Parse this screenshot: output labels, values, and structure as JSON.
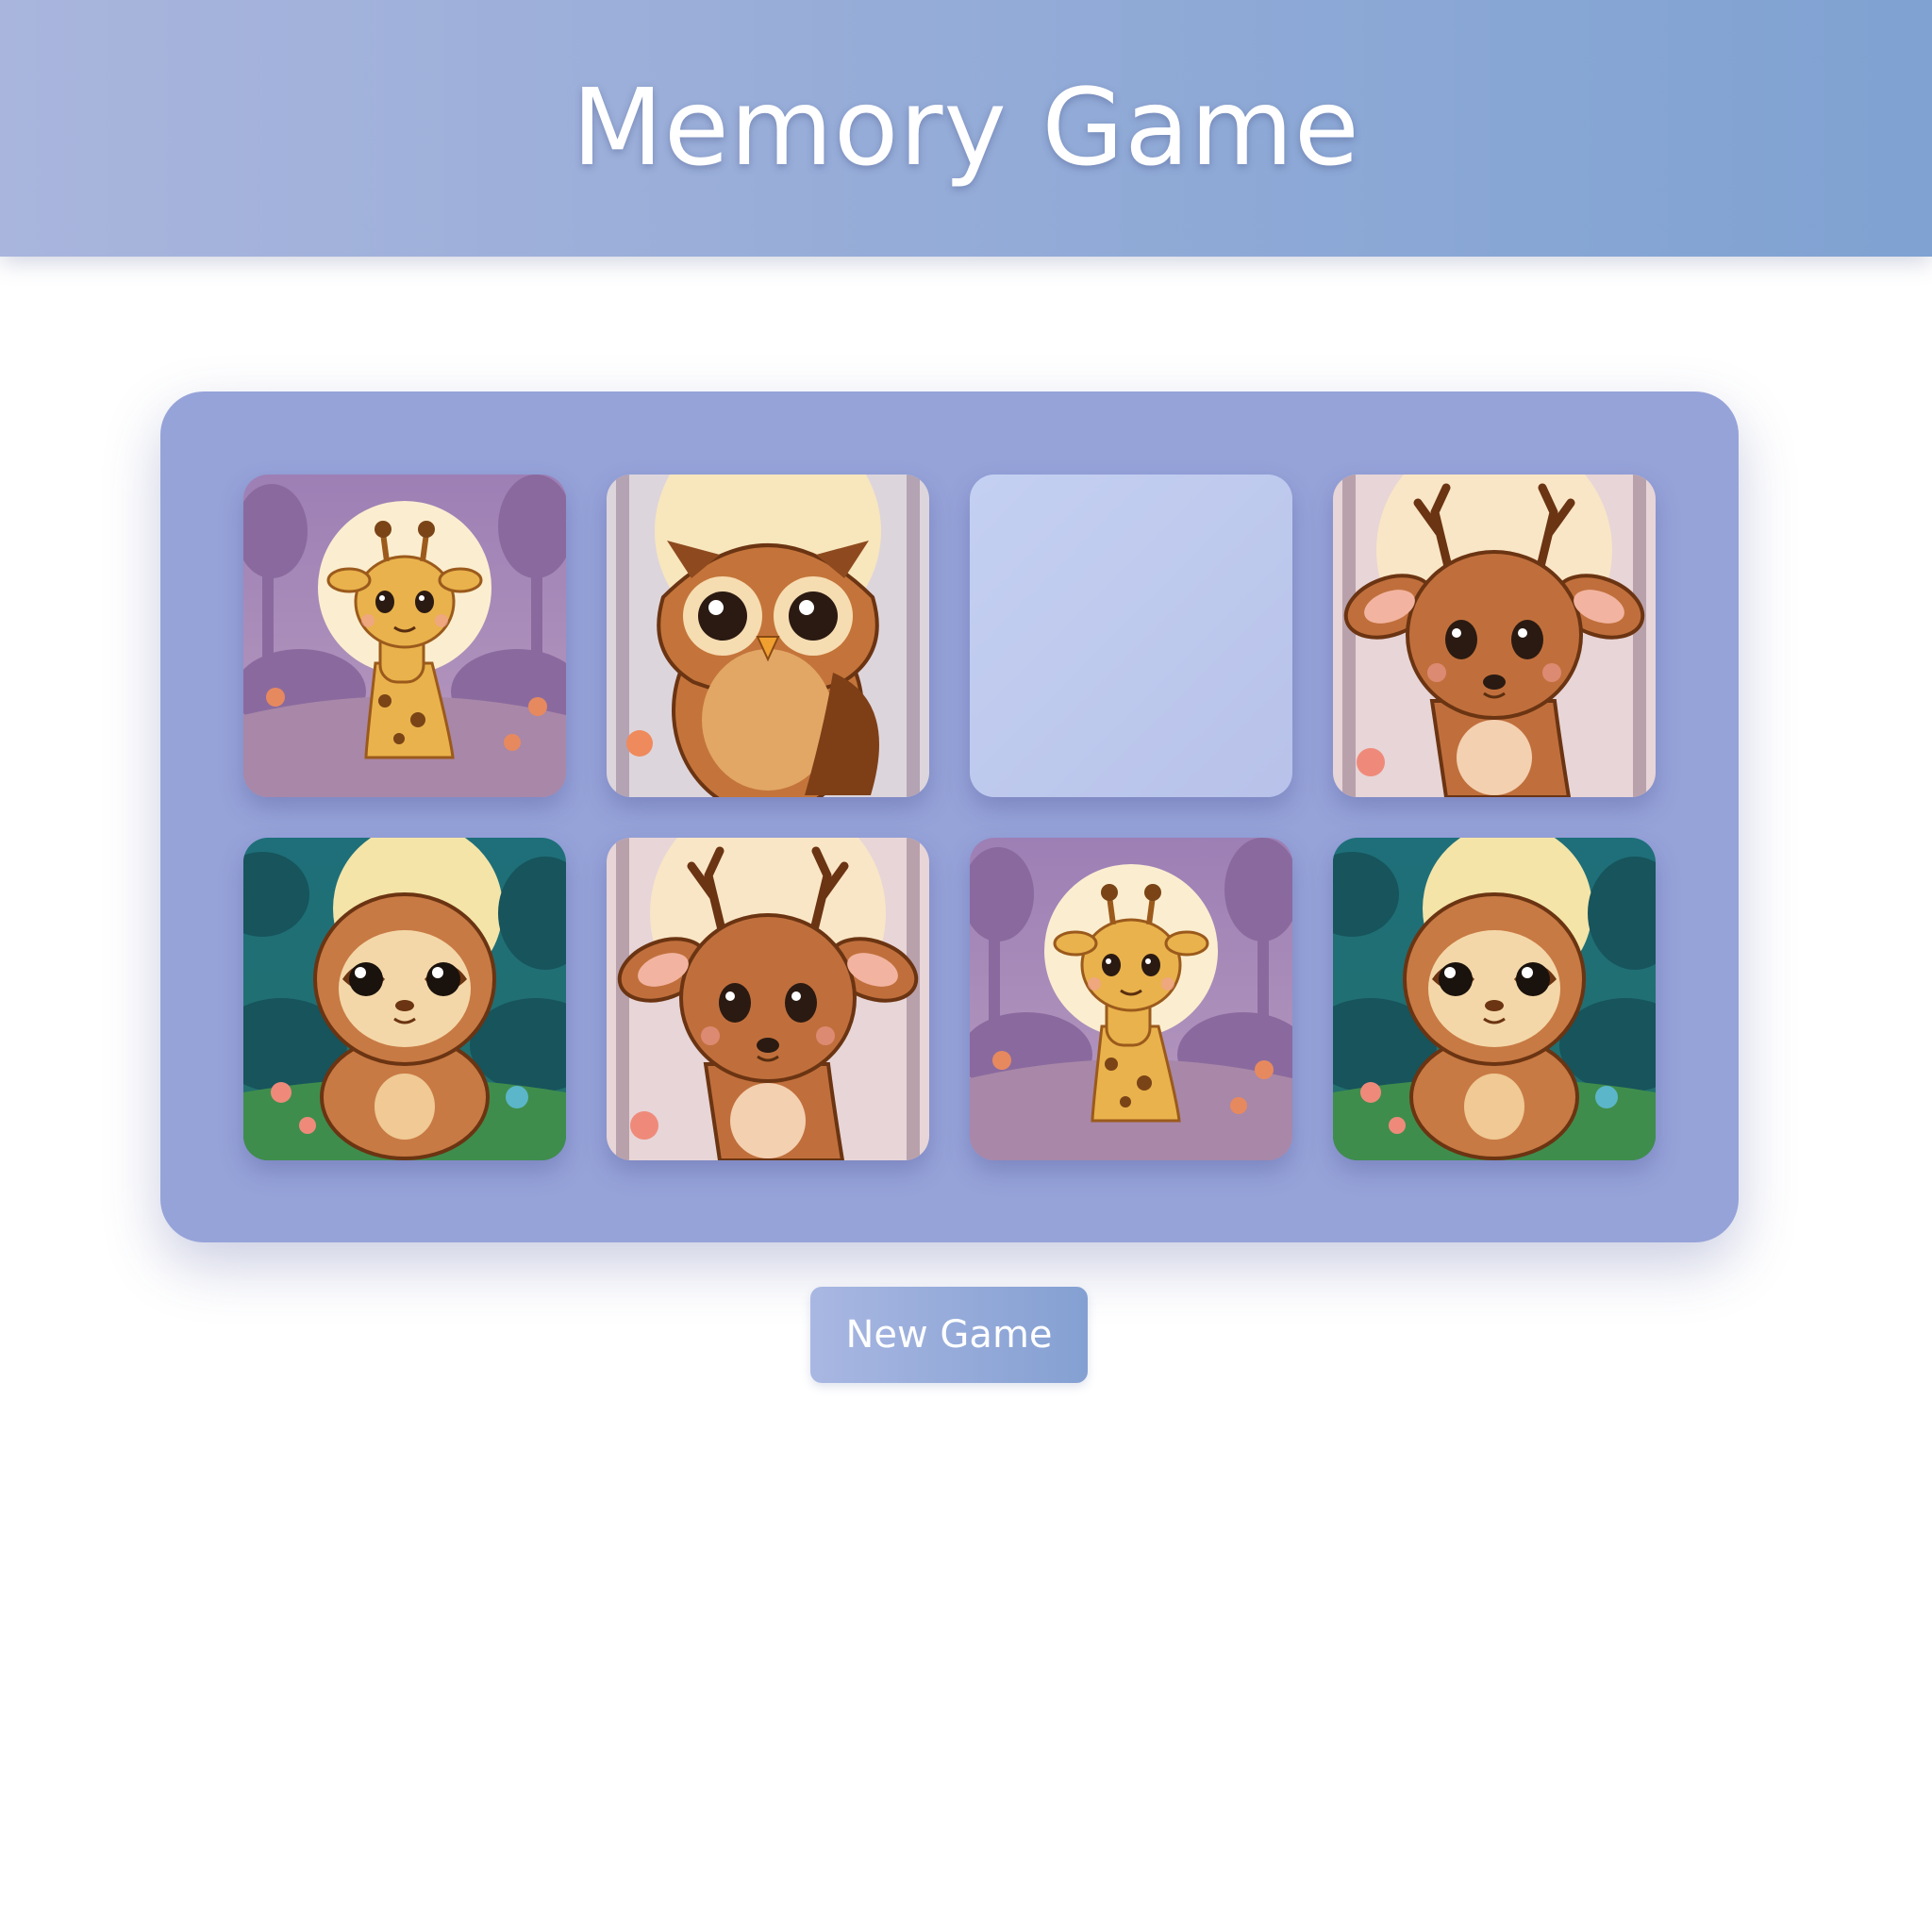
{
  "app": {
    "title": "Memory Game"
  },
  "colors": {
    "header_gradient_start": "#a9b5dd",
    "header_gradient_end": "#7fa2d2",
    "board_background": "#96a3d9",
    "button_gradient_start": "#a9b7e2",
    "button_gradient_end": "#84a0d2",
    "facedown_card": "#b8c2ea"
  },
  "board": {
    "rows": 2,
    "columns": 4,
    "cards": [
      {
        "state": "face-up",
        "animal": "giraffe",
        "icon": "giraffe-icon"
      },
      {
        "state": "face-up",
        "animal": "owl",
        "icon": "owl-icon"
      },
      {
        "state": "face-down",
        "animal": "",
        "icon": ""
      },
      {
        "state": "face-up",
        "animal": "deer",
        "icon": "deer-icon"
      },
      {
        "state": "face-up",
        "animal": "sloth",
        "icon": "sloth-icon"
      },
      {
        "state": "face-up",
        "animal": "deer",
        "icon": "deer-icon"
      },
      {
        "state": "face-up",
        "animal": "giraffe",
        "icon": "giraffe-icon"
      },
      {
        "state": "face-up",
        "animal": "sloth",
        "icon": "sloth-icon"
      }
    ]
  },
  "controls": {
    "new_game_label": "New Game"
  }
}
